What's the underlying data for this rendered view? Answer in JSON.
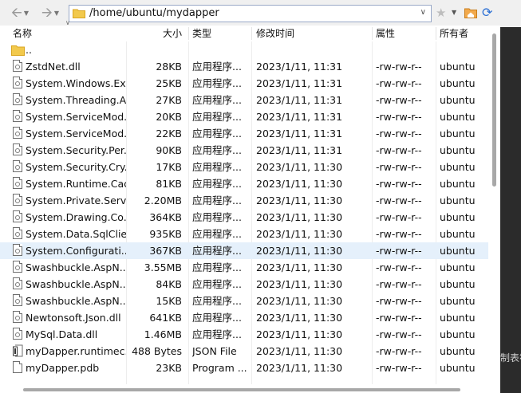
{
  "toolbar": {
    "back_icon": "arrow-left-icon",
    "forward_icon": "arrow-right-icon",
    "path": "/home/ubuntu/mydapper"
  },
  "columns": {
    "name": "名称",
    "size": "大小",
    "type": "类型",
    "modified": "修改时间",
    "attributes": "属性",
    "owner": "所有者"
  },
  "rows": [
    {
      "icon": "folder-icon",
      "name": "..",
      "size": "",
      "type": "",
      "modified": "",
      "attributes": "",
      "owner": ""
    },
    {
      "icon": "dll-file-icon",
      "name": "ZstdNet.dll",
      "size": "28KB",
      "type": "应用程序...",
      "modified": "2023/1/11, 11:31",
      "attributes": "-rw-rw-r--",
      "owner": "ubuntu"
    },
    {
      "icon": "dll-file-icon",
      "name": "System.Windows.Ex...",
      "size": "25KB",
      "type": "应用程序...",
      "modified": "2023/1/11, 11:31",
      "attributes": "-rw-rw-r--",
      "owner": "ubuntu"
    },
    {
      "icon": "dll-file-icon",
      "name": "System.Threading.A...",
      "size": "27KB",
      "type": "应用程序...",
      "modified": "2023/1/11, 11:31",
      "attributes": "-rw-rw-r--",
      "owner": "ubuntu"
    },
    {
      "icon": "dll-file-icon",
      "name": "System.ServiceMod...",
      "size": "20KB",
      "type": "应用程序...",
      "modified": "2023/1/11, 11:31",
      "attributes": "-rw-rw-r--",
      "owner": "ubuntu"
    },
    {
      "icon": "dll-file-icon",
      "name": "System.ServiceMod...",
      "size": "22KB",
      "type": "应用程序...",
      "modified": "2023/1/11, 11:31",
      "attributes": "-rw-rw-r--",
      "owner": "ubuntu"
    },
    {
      "icon": "dll-file-icon",
      "name": "System.Security.Per...",
      "size": "90KB",
      "type": "应用程序...",
      "modified": "2023/1/11, 11:31",
      "attributes": "-rw-rw-r--",
      "owner": "ubuntu"
    },
    {
      "icon": "dll-file-icon",
      "name": "System.Security.Cry...",
      "size": "17KB",
      "type": "应用程序...",
      "modified": "2023/1/11, 11:30",
      "attributes": "-rw-rw-r--",
      "owner": "ubuntu"
    },
    {
      "icon": "dll-file-icon",
      "name": "System.Runtime.Cac...",
      "size": "81KB",
      "type": "应用程序...",
      "modified": "2023/1/11, 11:30",
      "attributes": "-rw-rw-r--",
      "owner": "ubuntu"
    },
    {
      "icon": "dll-file-icon",
      "name": "System.Private.Servi...",
      "size": "2.20MB",
      "type": "应用程序...",
      "modified": "2023/1/11, 11:30",
      "attributes": "-rw-rw-r--",
      "owner": "ubuntu"
    },
    {
      "icon": "dll-file-icon",
      "name": "System.Drawing.Co...",
      "size": "364KB",
      "type": "应用程序...",
      "modified": "2023/1/11, 11:30",
      "attributes": "-rw-rw-r--",
      "owner": "ubuntu"
    },
    {
      "icon": "dll-file-icon",
      "name": "System.Data.SqlClie...",
      "size": "935KB",
      "type": "应用程序...",
      "modified": "2023/1/11, 11:30",
      "attributes": "-rw-rw-r--",
      "owner": "ubuntu"
    },
    {
      "icon": "dll-file-icon",
      "name": "System.Configurati...",
      "size": "367KB",
      "type": "应用程序...",
      "modified": "2023/1/11, 11:30",
      "attributes": "-rw-rw-r--",
      "owner": "ubuntu",
      "selected": true
    },
    {
      "icon": "dll-file-icon",
      "name": "Swashbuckle.AspN...",
      "size": "3.55MB",
      "type": "应用程序...",
      "modified": "2023/1/11, 11:30",
      "attributes": "-rw-rw-r--",
      "owner": "ubuntu"
    },
    {
      "icon": "dll-file-icon",
      "name": "Swashbuckle.AspN...",
      "size": "84KB",
      "type": "应用程序...",
      "modified": "2023/1/11, 11:30",
      "attributes": "-rw-rw-r--",
      "owner": "ubuntu"
    },
    {
      "icon": "dll-file-icon",
      "name": "Swashbuckle.AspN...",
      "size": "15KB",
      "type": "应用程序...",
      "modified": "2023/1/11, 11:30",
      "attributes": "-rw-rw-r--",
      "owner": "ubuntu"
    },
    {
      "icon": "dll-file-icon",
      "name": "Newtonsoft.Json.dll",
      "size": "641KB",
      "type": "应用程序...",
      "modified": "2023/1/11, 11:30",
      "attributes": "-rw-rw-r--",
      "owner": "ubuntu"
    },
    {
      "icon": "dll-file-icon",
      "name": "MySql.Data.dll",
      "size": "1.46MB",
      "type": "应用程序...",
      "modified": "2023/1/11, 11:30",
      "attributes": "-rw-rw-r--",
      "owner": "ubuntu"
    },
    {
      "icon": "json-file-icon",
      "name": "myDapper.runtimec...",
      "size": "488 Bytes",
      "type": "JSON File",
      "modified": "2023/1/11, 11:30",
      "attributes": "-rw-rw-r--",
      "owner": "ubuntu"
    },
    {
      "icon": "pdb-file-icon",
      "name": "myDapper.pdb",
      "size": "23KB",
      "type": "Program ...",
      "modified": "2023/1/11, 11:30",
      "attributes": "-rw-rw-r--",
      "owner": "ubuntu"
    }
  ],
  "side_text": "制表符",
  "colors": {
    "selected_row": "#e5f0fb",
    "folder": "#f2c94c",
    "refresh": "#2b6fd4"
  }
}
